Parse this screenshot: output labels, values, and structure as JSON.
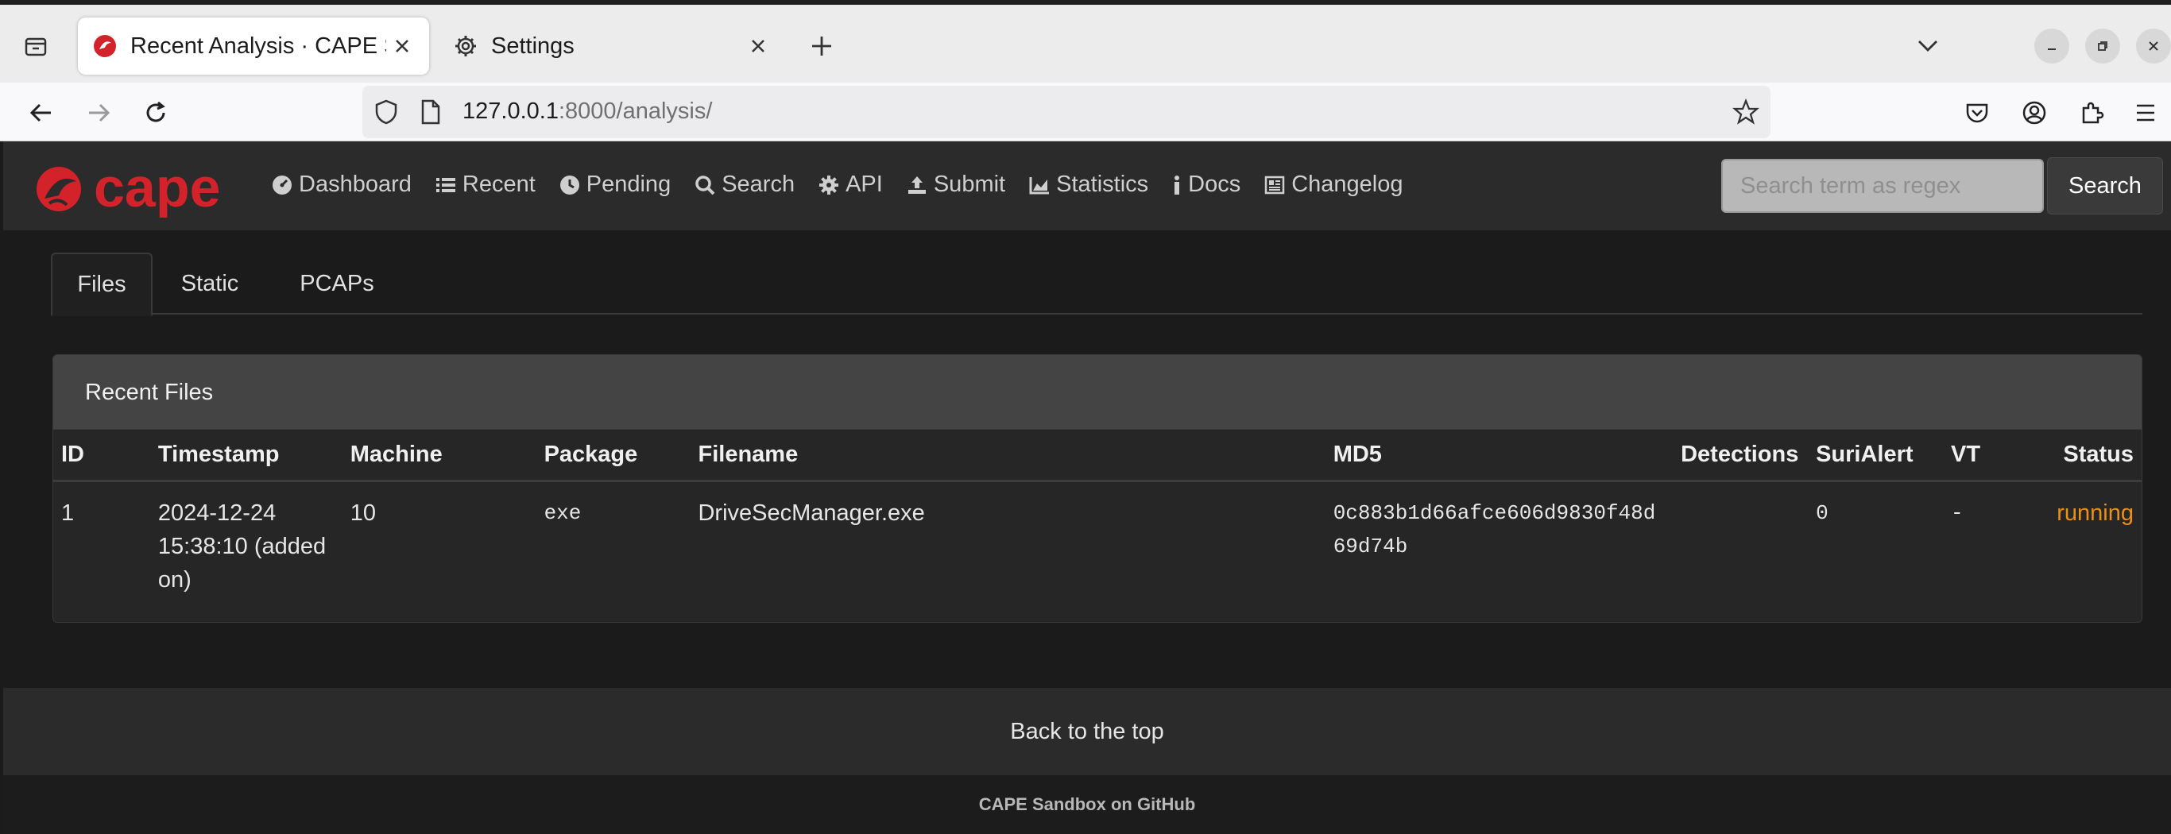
{
  "browser": {
    "tabs": [
      {
        "title": "Recent Analysis · CAPE Sandbox"
      },
      {
        "title": "Settings"
      }
    ],
    "url_host": "127.0.0.1",
    "url_rest": ":8000/analysis/"
  },
  "nav": {
    "brand": "cape",
    "items": [
      "Dashboard",
      "Recent",
      "Pending",
      "Search",
      "API",
      "Submit",
      "Statistics",
      "Docs",
      "Changelog"
    ],
    "search_placeholder": "Search term as regex",
    "search_button": "Search"
  },
  "tabs": [
    "Files",
    "Static",
    "PCAPs"
  ],
  "recent": {
    "header": "Recent Files",
    "columns": [
      "ID",
      "Timestamp",
      "Machine",
      "Package",
      "Filename",
      "MD5",
      "Detections",
      "SuriAlert",
      "VT",
      "Status"
    ],
    "rows": [
      {
        "id": "1",
        "timestamp": "2024-12-24 15:38:10 (added on)",
        "machine": "10",
        "package": "exe",
        "filename": "DriveSecManager.exe",
        "md5": "0c883b1d66afce606d9830f48d69d74b",
        "detections": "",
        "surialert": "0",
        "vt": "-",
        "status": "running"
      }
    ]
  },
  "footer": {
    "back_to_top": "Back to the top",
    "github": "CAPE Sandbox on GitHub"
  },
  "colors": {
    "brand_red": "#d3222a",
    "status_running": "#e8901a",
    "navbar_bg": "#2b2b2b"
  }
}
